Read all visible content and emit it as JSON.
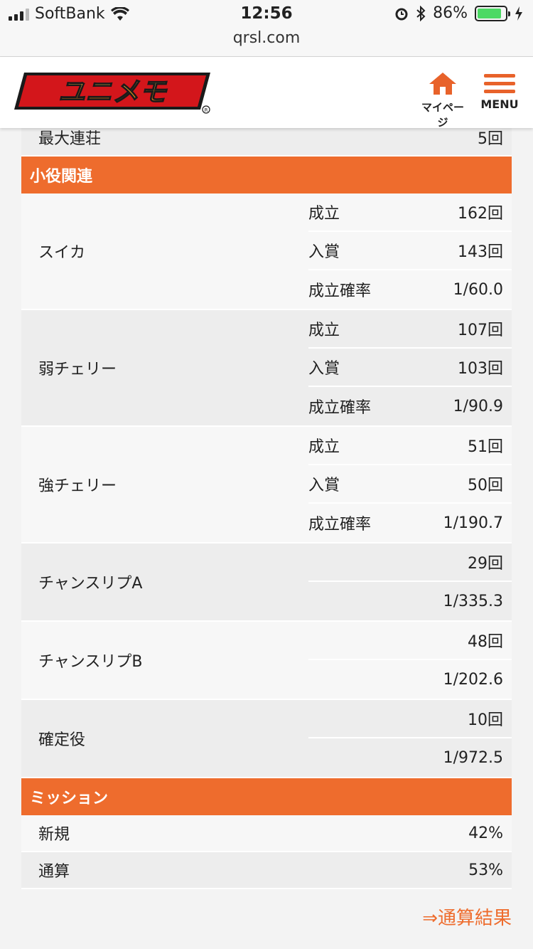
{
  "status_bar": {
    "carrier": "SoftBank",
    "time": "12:56",
    "battery": "86%",
    "battery_level": 0.86,
    "url": "qrsl.com"
  },
  "header": {
    "logo_text": "ユニメモ",
    "mypage_label": "マイページ",
    "menu_label": "MENU"
  },
  "top_row": {
    "label": "最大連荘",
    "value": "5回"
  },
  "section_small": {
    "title": "小役関連"
  },
  "groups": [
    {
      "label": "スイカ",
      "rows": [
        {
          "label": "成立",
          "value": "162回"
        },
        {
          "label": "入賞",
          "value": "143回"
        },
        {
          "label": "成立確率",
          "value": "1/60.0"
        }
      ]
    },
    {
      "label": "弱チェリー",
      "rows": [
        {
          "label": "成立",
          "value": "107回"
        },
        {
          "label": "入賞",
          "value": "103回"
        },
        {
          "label": "成立確率",
          "value": "1/90.9"
        }
      ]
    },
    {
      "label": "強チェリー",
      "rows": [
        {
          "label": "成立",
          "value": "51回"
        },
        {
          "label": "入賞",
          "value": "50回"
        },
        {
          "label": "成立確率",
          "value": "1/190.7"
        }
      ]
    },
    {
      "label": "チャンスリプA",
      "rows": [
        {
          "label": "",
          "value": "29回"
        },
        {
          "label": "",
          "value": "1/335.3"
        }
      ]
    },
    {
      "label": "チャンスリプB",
      "rows": [
        {
          "label": "",
          "value": "48回"
        },
        {
          "label": "",
          "value": "1/202.6"
        }
      ]
    },
    {
      "label": "確定役",
      "rows": [
        {
          "label": "",
          "value": "10回"
        },
        {
          "label": "",
          "value": "1/972.5"
        }
      ]
    }
  ],
  "section_mission": {
    "title": "ミッション"
  },
  "mission_rows": [
    {
      "label": "新規",
      "value": "42%"
    },
    {
      "label": "通算",
      "value": "53%"
    }
  ],
  "link": {
    "text": "⇒通算結果"
  },
  "colors": {
    "accent": "#ee6c2d",
    "row_light": "#f7f7f7",
    "row_dark": "#ededed"
  }
}
